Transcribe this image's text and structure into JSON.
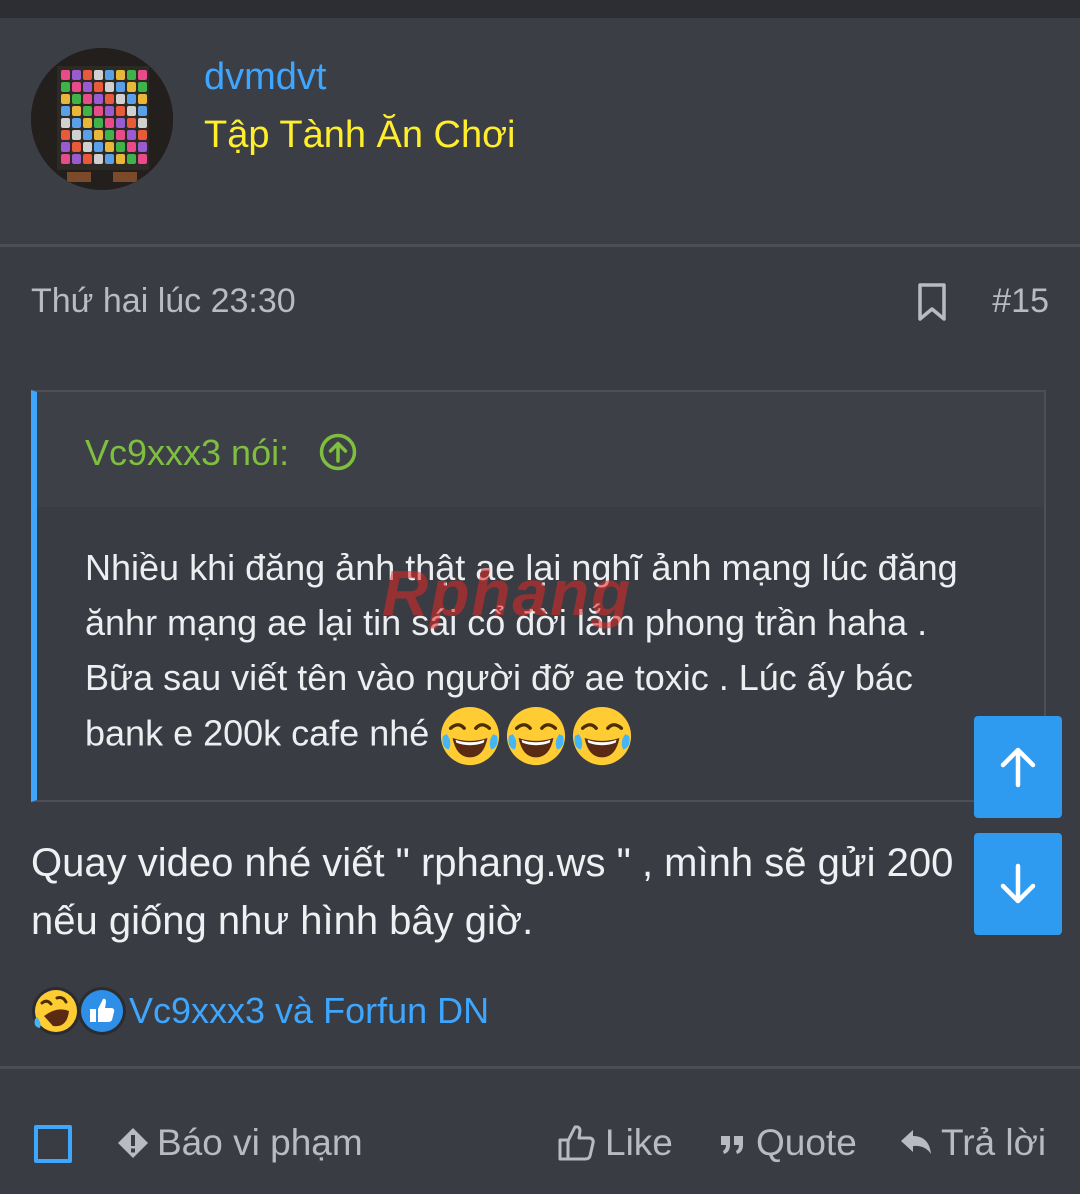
{
  "user": {
    "name": "dvmdvt",
    "title": "Tập Tành Ăn Chơi"
  },
  "post": {
    "date": "Thứ hai lúc 23:30",
    "number": "#15",
    "quote": {
      "author_label": "Vc9xxx3 nói:",
      "text": "Nhiều khi đăng ảnh thật ae lại nghĩ ảnh mạng lúc đăng ănhr mạng ae lại tin sái cổ đời lắm phong trần haha . Bữa sau viết tên vào người đỡ ae toxic . Lúc ấy bác bank e 200k cafe nhé",
      "emojis": [
        "tears-of-joy-emoji",
        "tears-of-joy-emoji",
        "tears-of-joy-emoji"
      ]
    },
    "body_lines": [
      "Quay video nhé viết \" rphang.ws \" , mình sẽ gửi 200",
      "nếu giống như hình bây giờ."
    ],
    "reactions": {
      "icons": [
        "rofl-emoji",
        "like-reaction-icon"
      ],
      "users": "Vc9xxx3 và Forfun DN"
    }
  },
  "watermark": "Rphang",
  "actions": {
    "report": "Báo vi phạm",
    "like": "Like",
    "quote": "Quote",
    "reply": "Trả lời"
  },
  "colors": {
    "background": "#393c42",
    "accent": "#3ea6ff",
    "user_title": "#ffee2e",
    "quote_author": "#7fbf3f",
    "scroll_button": "#2e9bf0"
  }
}
